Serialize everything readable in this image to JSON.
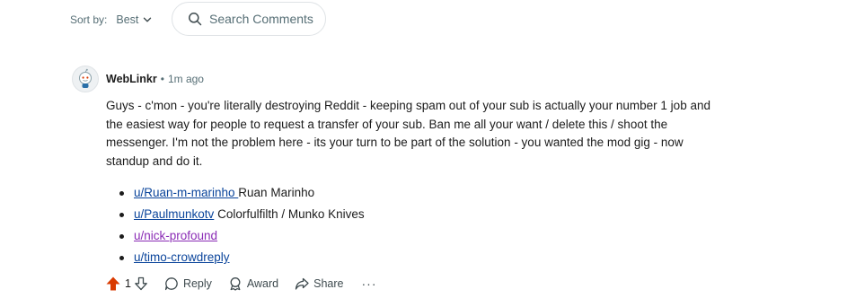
{
  "sort": {
    "label": "Sort by:",
    "value": "Best"
  },
  "search": {
    "placeholder": "Search Comments"
  },
  "comment": {
    "author": "WebLinkr",
    "separator": "•",
    "time": "1m ago",
    "body": "Guys - c'mon - you're literally destroying Reddit - keeping spam out of your sub is actually your number 1 job and the easiest way for people to request a transfer of your sub. Ban me all your want / delete this / shoot the messenger. I'm not the problem here - its your turn to be part of the solution - you wanted the mod gig - now standup and do it.",
    "mentions": [
      {
        "link": "u/Ruan-m-marinho ",
        "text": "Ruan Marinho",
        "visited": false
      },
      {
        "link": "u/Paulmunkotv",
        "text": " Colorfulfilth / Munko Knives",
        "visited": false
      },
      {
        "link": "u/nick-profound",
        "text": "",
        "visited": true
      },
      {
        "link": "u/timo-crowdreply",
        "text": "",
        "visited": false
      }
    ]
  },
  "actions": {
    "vote_count": "1",
    "reply": "Reply",
    "award": "Award",
    "share": "Share",
    "more": "···"
  },
  "colors": {
    "upvote_active": "#d93a00",
    "link": "#0a449b",
    "link_visited": "#8a2bb5",
    "meta_text": "#576f76"
  },
  "icons": {
    "search": "search-icon",
    "sort": "chevron-down-icon",
    "upvote": "upvote-arrow-icon",
    "downvote": "downvote-arrow-icon",
    "reply": "comment-bubble-icon",
    "award": "award-icon",
    "share": "share-arrow-icon"
  }
}
